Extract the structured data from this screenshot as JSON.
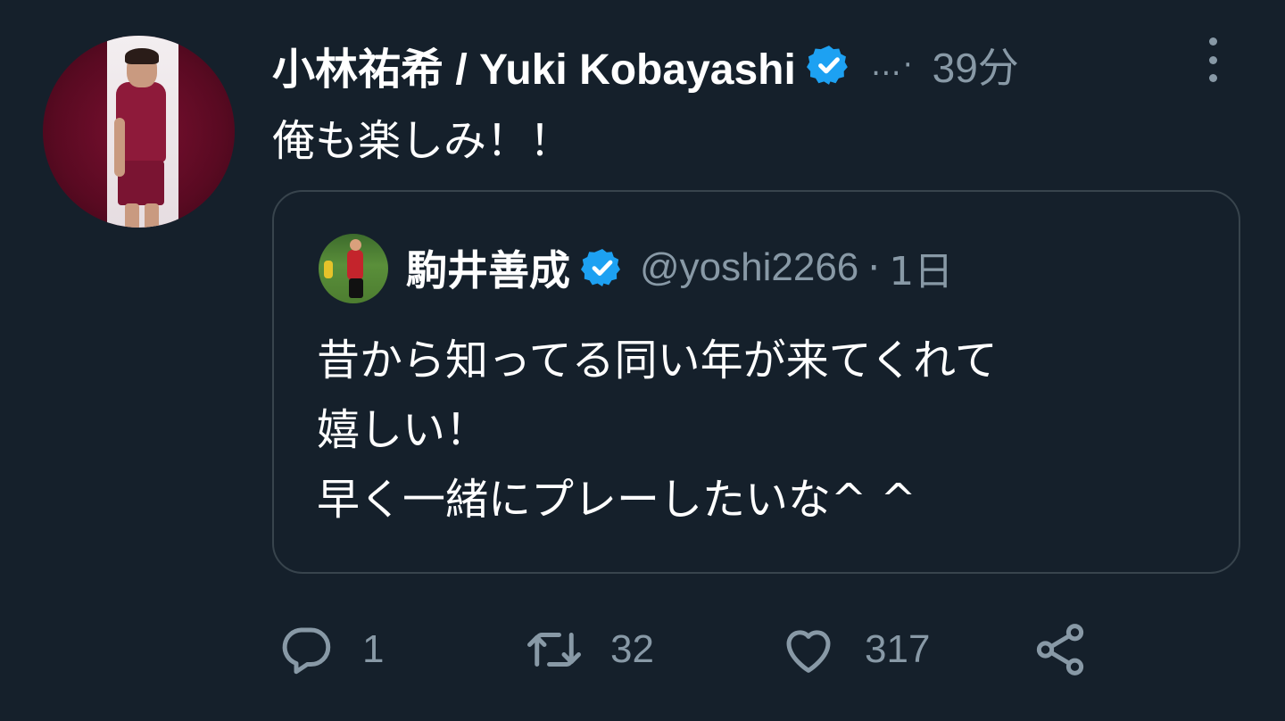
{
  "tweet": {
    "display_name": "小林祐希 / Yuki Kobayashi",
    "ellipsis": "…·",
    "time": "39分",
    "text": "俺も楽しみ！！"
  },
  "quoted": {
    "display_name": "駒井善成",
    "handle": "@yoshi2266",
    "separator": "·",
    "time": "1日",
    "lines": [
      "昔から知ってる同い年が来てくれて",
      "嬉しい！",
      "早く一緒にプレーしたいな^ ^"
    ]
  },
  "actions": {
    "reply_count": "1",
    "retweet_count": "32",
    "like_count": "317"
  },
  "colors": {
    "background": "#15202b",
    "secondary_text": "#8899a6",
    "verified": "#1da1f2",
    "border": "#38444d"
  },
  "icons": [
    "verified-badge-icon",
    "more-icon",
    "reply-icon",
    "retweet-icon",
    "like-icon",
    "share-icon"
  ]
}
